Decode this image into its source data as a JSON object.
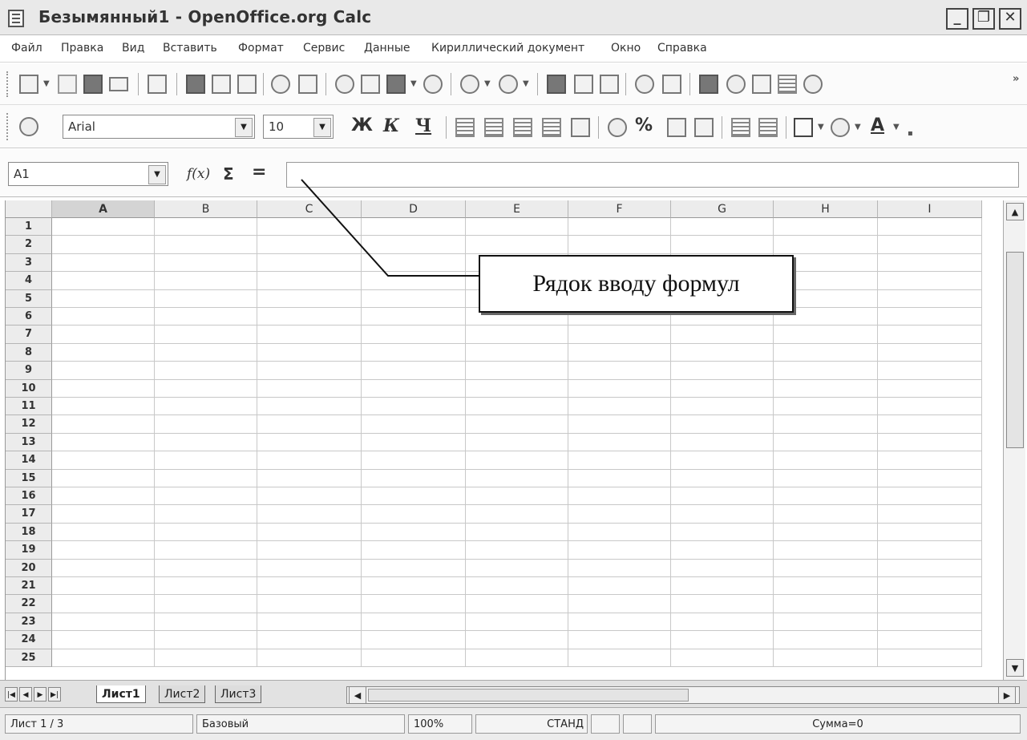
{
  "window": {
    "title": "Безымянный1 - OpenOffice.org Calc",
    "min": "_",
    "max": "❐",
    "close": "✕"
  },
  "menu": [
    "Файл",
    "Правка",
    "Вид",
    "Вставить",
    "Формат",
    "Сервис",
    "Данные",
    "Кириллический документ",
    "Окно",
    "Справка"
  ],
  "format_toolbar": {
    "font": "Arial",
    "size": "10",
    "bold": "Ж",
    "italic": "К",
    "underline": "Ч",
    "percent": "%",
    "font_color_letter": "A"
  },
  "formula_bar": {
    "name_box": "A1",
    "fx": "f(x)",
    "sum": "Σ",
    "equals": "=",
    "value": ""
  },
  "grid": {
    "columns": [
      "A",
      "B",
      "C",
      "D",
      "E",
      "F",
      "G",
      "H",
      "I"
    ],
    "rows": [
      "1",
      "2",
      "3",
      "4",
      "5",
      "6",
      "7",
      "8",
      "9",
      "10",
      "11",
      "12",
      "13",
      "14",
      "15",
      "16",
      "17",
      "18",
      "19",
      "20",
      "21",
      "22",
      "23",
      "24",
      "25"
    ],
    "active_column": "A"
  },
  "sheets": {
    "tabs": [
      "Лист1",
      "Лист2",
      "Лист3"
    ],
    "active": "Лист1"
  },
  "status": {
    "sheet": "Лист 1 / 3",
    "style": "Базовый",
    "zoom": "100%",
    "mode": "СТАНД",
    "sum": "Сумма=0"
  },
  "callout": {
    "text": "Рядок вводу формул"
  }
}
